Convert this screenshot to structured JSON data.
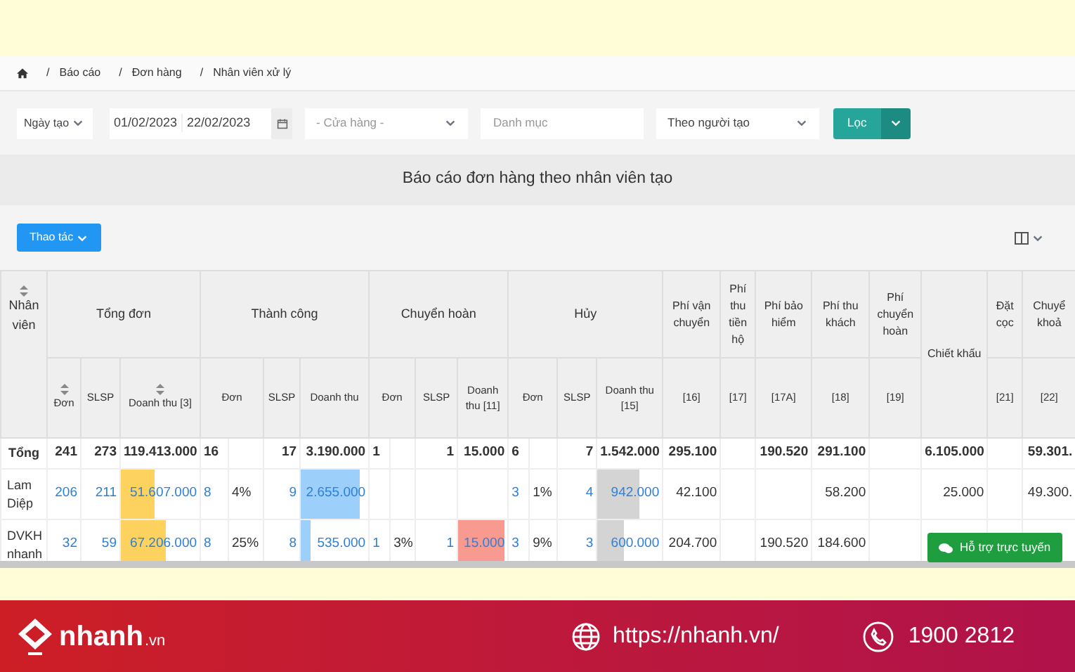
{
  "breadcrumb": {
    "separator": "/",
    "items": [
      "Báo cáo",
      "Đơn hàng",
      "Nhân viên xử lý"
    ]
  },
  "filters": {
    "date_type": "Ngày tạo",
    "date_from": "01/02/2023",
    "date_to": "22/02/2023",
    "store": {
      "placeholder": "- Cửa hàng -"
    },
    "category": {
      "placeholder": "Danh mục"
    },
    "mode": "Theo người tạo",
    "filter_button": "Lọc"
  },
  "report_title": "Báo cáo đơn hàng theo nhân viên tạo",
  "actions_button": "Thao tác",
  "table": {
    "name_header": {
      "label": "Nhân viên",
      "sortable": true
    },
    "groups": [
      {
        "label": "Tổng đơn",
        "sub": [
          {
            "label": "Đơn",
            "sortable": true,
            "kind": "single"
          },
          {
            "label": "SLSP",
            "sortable": false,
            "kind": "single"
          },
          {
            "label": "Doanh thu [3]",
            "sortable": true,
            "kind": "single"
          }
        ]
      },
      {
        "label": "Thành công",
        "sub": [
          {
            "label": "Đơn",
            "sortable": false,
            "kind": "paired"
          },
          {
            "label": "SLSP",
            "sortable": false,
            "kind": "single"
          },
          {
            "label": "Doanh thu",
            "sortable": false,
            "kind": "single"
          }
        ]
      },
      {
        "label": "Chuyển hoàn",
        "sub": [
          {
            "label": "Đơn",
            "sortable": false,
            "kind": "paired"
          },
          {
            "label": "SLSP",
            "sortable": false,
            "kind": "single"
          },
          {
            "label": "Doanh thu [11]",
            "sortable": false,
            "kind": "single"
          }
        ]
      },
      {
        "label": "Hủy",
        "sub": [
          {
            "label": "Đơn",
            "sortable": false,
            "kind": "paired"
          },
          {
            "label": "SLSP",
            "sortable": false,
            "kind": "single"
          },
          {
            "label": "Doanh thu [15]",
            "sortable": false,
            "kind": "single"
          }
        ]
      },
      {
        "label": "Phí vận chuyển",
        "sub": [
          {
            "label": "[16]",
            "sortable": false,
            "kind": "single"
          }
        ]
      },
      {
        "label": "Phí thu tiền hộ",
        "sub": [
          {
            "label": "[17]",
            "sortable": false,
            "kind": "single"
          }
        ]
      },
      {
        "label": "Phí bảo hiểm",
        "sub": [
          {
            "label": "[17A]",
            "sortable": false,
            "kind": "single"
          }
        ]
      },
      {
        "label": "Phí thu khách",
        "sub": [
          {
            "label": "[18]",
            "sortable": false,
            "kind": "single"
          }
        ]
      },
      {
        "label": "Phí chuyển hoàn",
        "sub": [
          {
            "label": "[19]",
            "sortable": false,
            "kind": "single"
          }
        ]
      },
      {
        "label": "Chiết khấu"
      },
      {
        "label": "Đặt cọc",
        "sub": [
          {
            "label": "[21]",
            "sortable": false,
            "kind": "single"
          }
        ]
      },
      {
        "label": "Chuyể khoả",
        "sub": [
          {
            "label": "[22]",
            "sortable": false,
            "kind": "single"
          }
        ]
      }
    ],
    "rows": [
      {
        "name": "Tổng",
        "total": true,
        "cells": [
          "241",
          "273",
          "119.413.000",
          "16",
          null,
          "17",
          "3.190.000",
          "1",
          null,
          "1",
          "15.000",
          "6",
          null,
          "7",
          "1.542.000",
          "295.100",
          null,
          "190.520",
          "291.100",
          null,
          "6.105.000",
          null,
          "59.301."
        ]
      },
      {
        "name": "Lam Diệp",
        "total": false,
        "cells": [
          "206",
          "211",
          {
            "text": "51.607.000",
            "level": 0.43,
            "color": "#fdd25e"
          },
          "8",
          "4%",
          "9",
          {
            "text": "2.655.000",
            "level": 0.88,
            "color": "#9ccffa"
          },
          null,
          null,
          null,
          null,
          "3",
          "1%",
          "4",
          {
            "text": "942.000",
            "level": 0.65,
            "color": "#d4d4d4"
          },
          "42.100",
          null,
          null,
          "58.200",
          null,
          "25.000",
          null,
          "49.300."
        ]
      },
      {
        "name": "DVKH nhanh",
        "total": false,
        "cells": [
          "32",
          "59",
          {
            "text": "67.206.000",
            "level": 0.57,
            "color": "#fdd25e"
          },
          "8",
          "25%",
          "8",
          {
            "text": "535.000",
            "level": 0.15,
            "color": "#9ccffa"
          },
          "1",
          "3%",
          "1",
          {
            "text": "15.000",
            "level": 0.95,
            "color": "#f99a91"
          },
          "3",
          "9%",
          "3",
          {
            "text": "600.000",
            "level": 0.4,
            "color": "#d4d4d4"
          },
          "204.700",
          null,
          "190.520",
          "184.600",
          null,
          null,
          null,
          null
        ]
      }
    ]
  },
  "chat_button": "Hỗ trợ trực tuyến",
  "footer": {
    "brand": "nhanh",
    "brand_suffix": ".vn",
    "website": "https://nhanh.vn/",
    "phone": "1900 2812"
  }
}
